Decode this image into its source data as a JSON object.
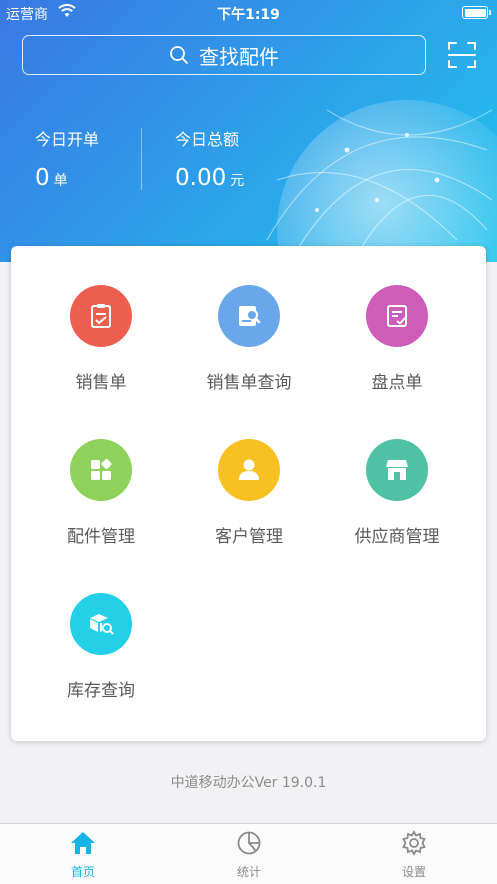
{
  "status_bar": {
    "carrier": "运营商",
    "time": "下午1:19"
  },
  "search": {
    "placeholder": "查找配件"
  },
  "stats": [
    {
      "label": "今日开单",
      "value": "0",
      "unit": "单"
    },
    {
      "label": "今日总额",
      "value": "0.00",
      "unit": "元"
    }
  ],
  "menu": [
    {
      "label": "销售单",
      "icon": "sales-order-icon",
      "color": "#ec5f4e"
    },
    {
      "label": "销售单查询",
      "icon": "sales-query-icon",
      "color": "#6aa6ea"
    },
    {
      "label": "盘点单",
      "icon": "inventory-check-icon",
      "color": "#cd5db9"
    },
    {
      "label": "配件管理",
      "icon": "parts-management-icon",
      "color": "#8fd25b"
    },
    {
      "label": "客户管理",
      "icon": "customer-management-icon",
      "color": "#f9c021"
    },
    {
      "label": "供应商管理",
      "icon": "supplier-management-icon",
      "color": "#4fc1a4"
    },
    {
      "label": "库存查询",
      "icon": "stock-query-icon",
      "color": "#23d0e8"
    }
  ],
  "version": "中道移动办公Ver 19.0.1",
  "tabs": [
    {
      "label": "首页",
      "icon": "home-icon",
      "active": true
    },
    {
      "label": "统计",
      "icon": "pie-chart-icon",
      "active": false
    },
    {
      "label": "设置",
      "icon": "gear-icon",
      "active": false
    }
  ],
  "colors": {
    "accent": "#17b4e6"
  }
}
